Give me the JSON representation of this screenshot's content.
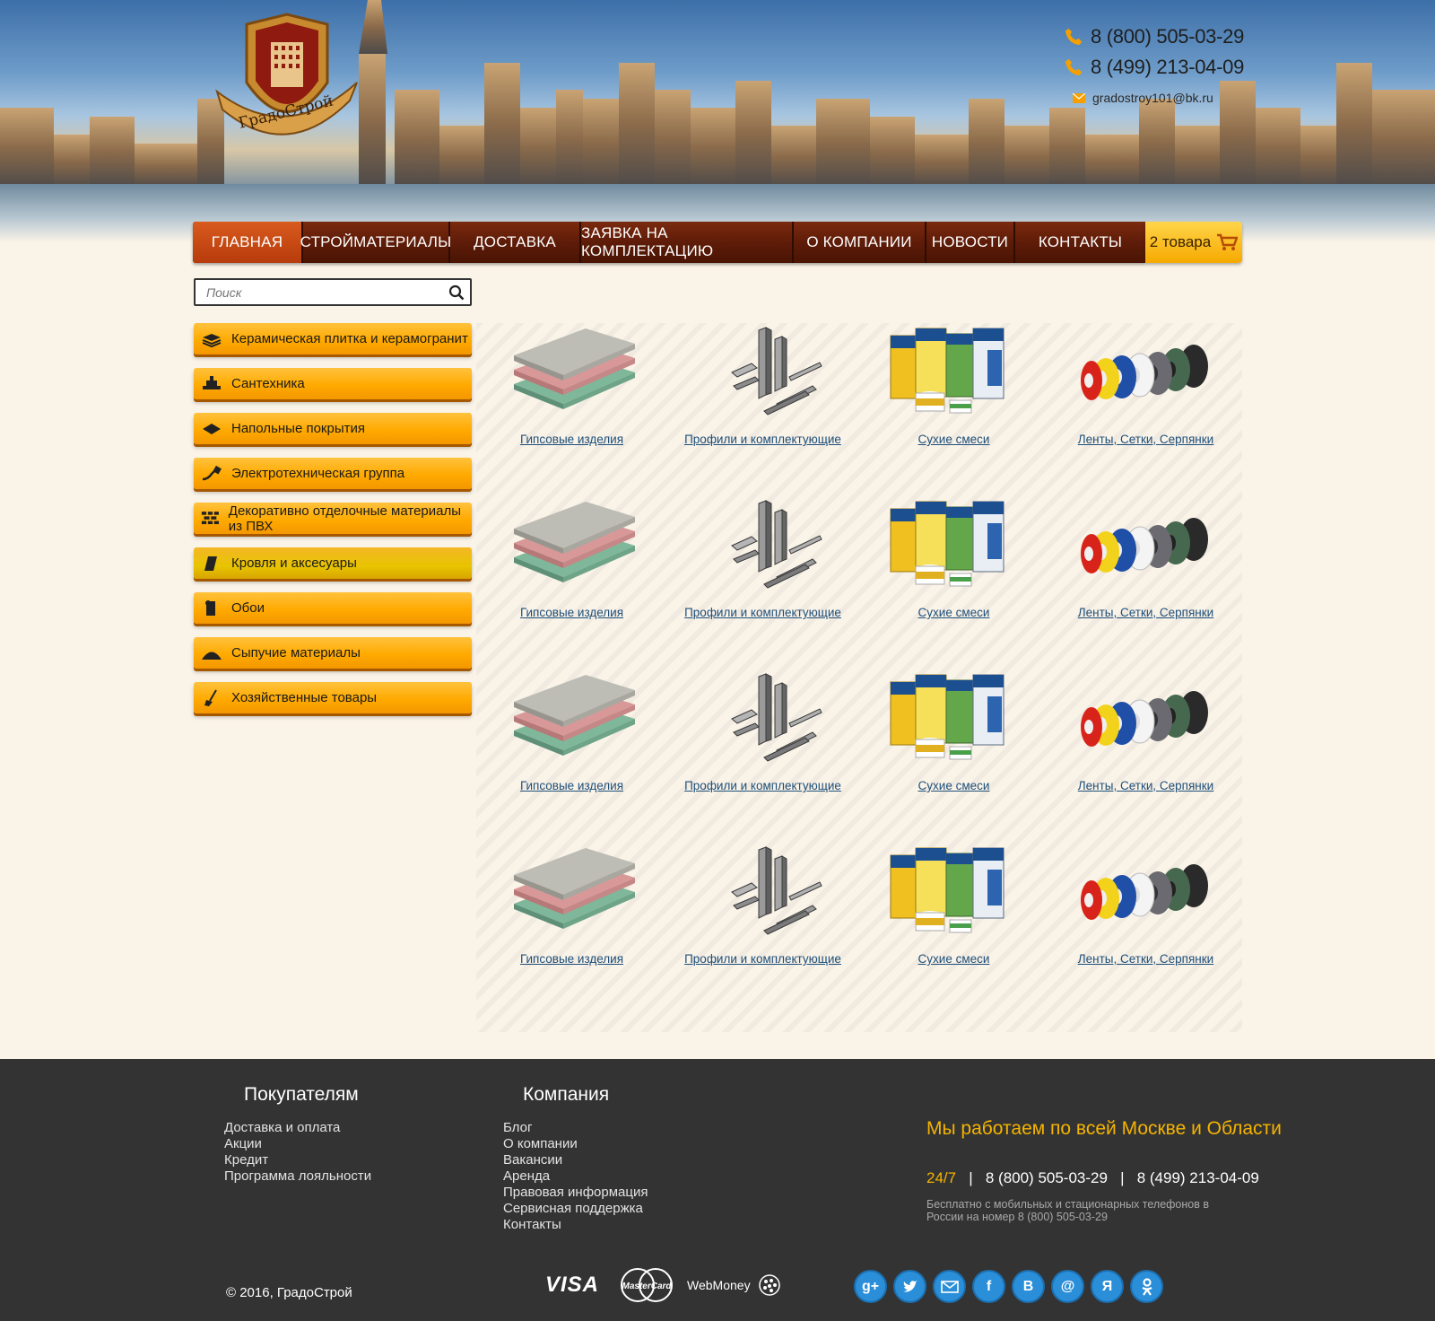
{
  "brand": {
    "name": "ГрадоСтрой"
  },
  "header": {
    "phones": [
      "8 (800) 505-03-29",
      "8 (499) 213-04-09"
    ],
    "email": "gradostroy101@bk.ru"
  },
  "nav": {
    "items": [
      "ГЛАВНАЯ",
      "СТРОЙМАТЕРИАЛЫ",
      "ДОСТАВКА",
      "ЗАЯВКА НА КОМПЛЕКТАЦИЮ",
      "О КОМПАНИИ",
      "НОВОСТИ",
      "КОНТАКТЫ"
    ],
    "active": "ГЛАВНАЯ",
    "cart_label": "2 товара"
  },
  "search": {
    "placeholder": "Поиск"
  },
  "categories": [
    {
      "label": "Керамическая плитка и керамогранит",
      "icon": "tiles-icon"
    },
    {
      "label": "Сантехника",
      "icon": "faucet-icon"
    },
    {
      "label": "Напольные покрытия",
      "icon": "floor-icon"
    },
    {
      "label": "Электротехническая группа",
      "icon": "plug-icon"
    },
    {
      "label": "Декоративно отделочные материалы из ПВХ",
      "icon": "bricks-icon"
    },
    {
      "label": "Кровля и аксесуары",
      "icon": "roof-icon"
    },
    {
      "label": "Обои",
      "icon": "wallpaper-icon"
    },
    {
      "label": "Сыпучие материалы",
      "icon": "pile-icon"
    },
    {
      "label": "Хозяйственные товары",
      "icon": "broom-icon"
    }
  ],
  "products": [
    "Гипсовые изделия",
    "Профили и комплектующие",
    "Сухие смеси",
    "Ленты, Сетки, Серпянки",
    "Гипсовые изделия",
    "Профили и комплектующие",
    "Сухие смеси",
    "Ленты, Сетки, Серпянки",
    "Гипсовые изделия",
    "Профили и комплектующие",
    "Сухие смеси",
    "Ленты, Сетки, Серпянки",
    "Гипсовые изделия",
    "Профили и комплектующие",
    "Сухие смеси",
    "Ленты, Сетки, Серпянки"
  ],
  "footer": {
    "buyers": {
      "title": "Покупателям",
      "links": [
        "Доставка и оплата",
        "Акции",
        "Кредит",
        "Программа лояльности"
      ]
    },
    "company": {
      "title": "Компания",
      "links": [
        "Блог",
        "О компании",
        "Вакансии",
        "Аренда",
        "Правовая информация",
        "Сервисная поддержка",
        "Контакты"
      ]
    },
    "region": "Мы работаем по всей Москве и Области",
    "hours": "24/7",
    "sep": "|",
    "phone1": "8 (800) 505-03-29",
    "phone2": "8 (499) 213-04-09",
    "note": "Бесплатно с мобильных и стационарных телефонов в России на номер 8 (800) 505-03-29",
    "copyright": "© 2016, ГрадоСтрой",
    "payments": [
      "VISA",
      "MasterCard",
      "WebMoney"
    ],
    "socials": [
      {
        "icon": "google-plus-icon",
        "glyph": "g+"
      },
      {
        "icon": "twitter-icon",
        "glyph": ""
      },
      {
        "icon": "mail-icon",
        "glyph": ""
      },
      {
        "icon": "facebook-icon",
        "glyph": "f"
      },
      {
        "icon": "vk-icon",
        "glyph": "B"
      },
      {
        "icon": "mailru-icon",
        "glyph": "@"
      },
      {
        "icon": "yandex-icon",
        "glyph": "Я"
      },
      {
        "icon": "odnoklassniki-icon",
        "glyph": ""
      }
    ]
  },
  "colors": {
    "accent": "#ffaa00",
    "nav": "#5e1c08",
    "nav_active": "#c4440f",
    "footer": "#333333",
    "link": "#1d4f7a"
  }
}
